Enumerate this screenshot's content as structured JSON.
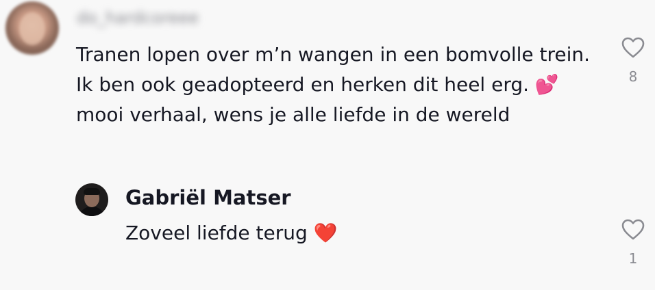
{
  "comments": [
    {
      "username": "do_hardcoreee",
      "text": "Tranen lopen over m’n wangen in een bomvolle trein.\nIk ben ook geadopteerd en herken dit heel erg. 💕\nmooi verhaal, wens je alle liefde in de wereld",
      "likes": "8",
      "like_icon": "heart-outline-icon"
    }
  ],
  "reply": {
    "name": "Gabriël Matser",
    "text": "Zoveel liefde terug ❤️",
    "likes": "1",
    "like_icon": "heart-outline-icon"
  },
  "colors": {
    "background": "#f8f8f8",
    "text": "#161823",
    "muted": "#8a8b91"
  }
}
